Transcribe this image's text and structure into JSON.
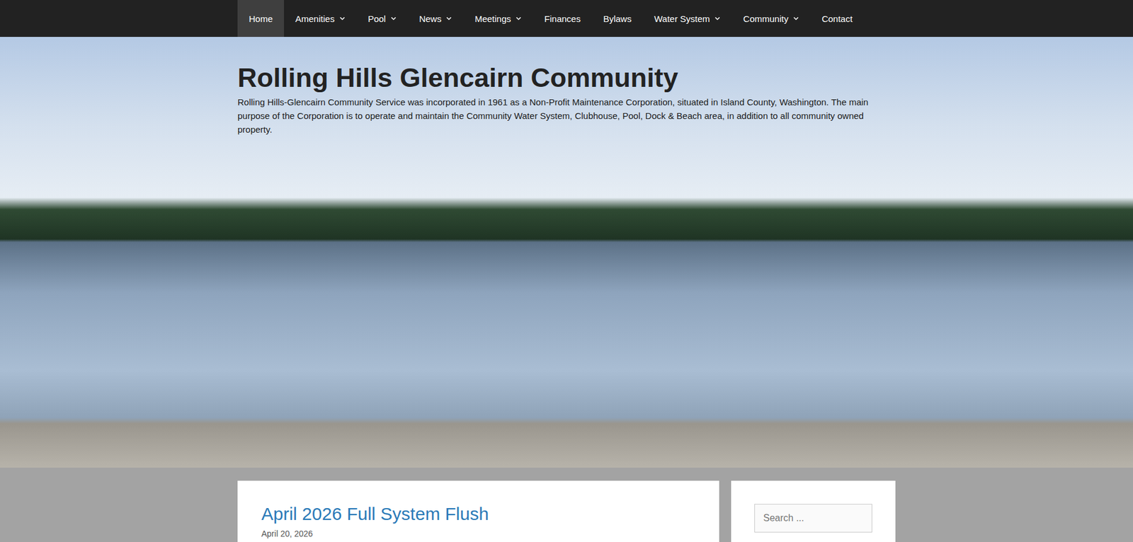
{
  "nav": [
    {
      "label": "Home",
      "selected": true,
      "dropdown": false
    },
    {
      "label": "Amenities",
      "selected": false,
      "dropdown": true
    },
    {
      "label": "Pool",
      "selected": false,
      "dropdown": true
    },
    {
      "label": "News",
      "selected": false,
      "dropdown": true
    },
    {
      "label": "Meetings",
      "selected": false,
      "dropdown": true
    },
    {
      "label": "Finances",
      "selected": false,
      "dropdown": false
    },
    {
      "label": "Bylaws",
      "selected": false,
      "dropdown": false
    },
    {
      "label": "Water System",
      "selected": false,
      "dropdown": true
    },
    {
      "label": "Community",
      "selected": false,
      "dropdown": true
    },
    {
      "label": "Contact",
      "selected": false,
      "dropdown": false
    }
  ],
  "site": {
    "title": "Rolling Hills Glencairn Community",
    "description": "Rolling Hills-Glencairn Community Service was incorporated in 1961 as a Non-Profit Maintenance Corporation, situated in Island County, Washington. The main purpose of the Corporation is to operate and maintain the Community Water System, Clubhouse, Pool, Dock & Beach area, in addition to all community owned property."
  },
  "posts": [
    {
      "title": "April 2026 Full System Flush",
      "date": "April 20, 2026"
    }
  ],
  "search": {
    "placeholder": "Search ..."
  }
}
